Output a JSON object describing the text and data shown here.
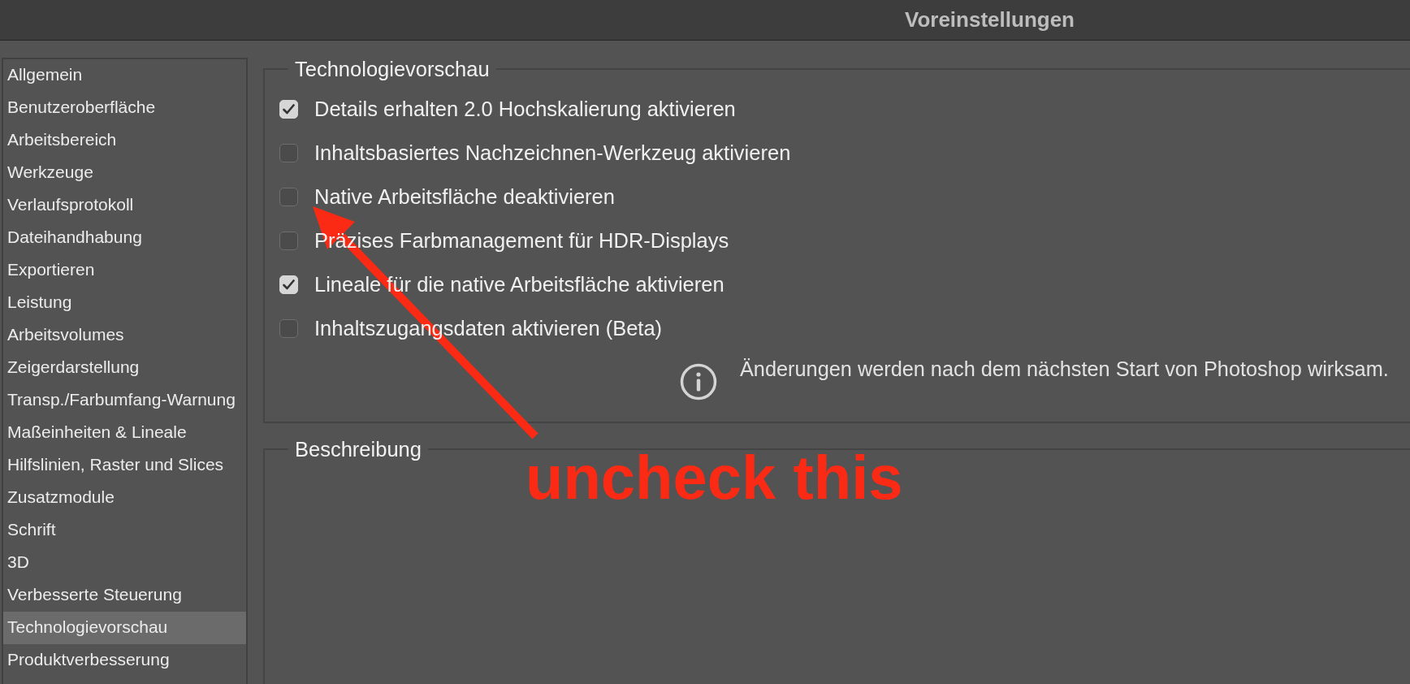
{
  "window": {
    "title": "Voreinstellungen"
  },
  "sidebar": {
    "items": [
      {
        "label": "Allgemein",
        "selected": false
      },
      {
        "label": "Benutzeroberfläche",
        "selected": false
      },
      {
        "label": "Arbeitsbereich",
        "selected": false
      },
      {
        "label": "Werkzeuge",
        "selected": false
      },
      {
        "label": "Verlaufsprotokoll",
        "selected": false
      },
      {
        "label": "Dateihandhabung",
        "selected": false
      },
      {
        "label": "Exportieren",
        "selected": false
      },
      {
        "label": "Leistung",
        "selected": false
      },
      {
        "label": "Arbeitsvolumes",
        "selected": false
      },
      {
        "label": "Zeigerdarstellung",
        "selected": false
      },
      {
        "label": "Transp./Farbumfang-Warnung",
        "selected": false
      },
      {
        "label": "Maßeinheiten & Lineale",
        "selected": false
      },
      {
        "label": "Hilfslinien, Raster und Slices",
        "selected": false
      },
      {
        "label": "Zusatzmodule",
        "selected": false
      },
      {
        "label": "Schrift",
        "selected": false
      },
      {
        "label": "3D",
        "selected": false
      },
      {
        "label": "Verbesserte Steuerung",
        "selected": false
      },
      {
        "label": "Technologievorschau",
        "selected": true
      },
      {
        "label": "Produktverbesserung",
        "selected": false
      }
    ]
  },
  "preview_group": {
    "title": "Technologievorschau",
    "options": [
      {
        "label": "Details erhalten 2.0 Hochskalierung aktivieren",
        "checked": true
      },
      {
        "label": "Inhaltsbasiertes Nachzeichnen-Werkzeug aktivieren",
        "checked": false
      },
      {
        "label": "Native Arbeitsfläche deaktivieren",
        "checked": false
      },
      {
        "label": "Präzises Farbmanagement für HDR-Displays",
        "checked": false
      },
      {
        "label": "Lineale für die native Arbeitsfläche aktivieren",
        "checked": true
      },
      {
        "label": "Inhaltszugangsdaten aktivieren (Beta)",
        "checked": false
      }
    ],
    "note": {
      "text": "Änderungen werden nach dem nächsten Start von Photoshop wirksam."
    }
  },
  "description_group": {
    "title": "Beschreibung"
  },
  "annotation": {
    "text": "uncheck this"
  }
}
